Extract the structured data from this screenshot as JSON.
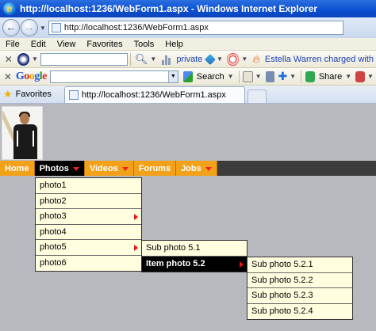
{
  "window": {
    "title": "http://localhost:1236/WebForm1.aspx - Windows Internet Explorer",
    "logo_letter": "e"
  },
  "address": {
    "url": "http://localhost:1236/WebForm1.aspx"
  },
  "menubar": [
    "File",
    "Edit",
    "View",
    "Favorites",
    "Tools",
    "Help"
  ],
  "toolbar1": {
    "private_label": "private",
    "news_text": "Estella Warren charged with"
  },
  "toolbar2": {
    "google": [
      "G",
      "o",
      "o",
      "g",
      "l",
      "e"
    ],
    "search_label": "Search",
    "share_label": "Share"
  },
  "tabs": {
    "favorites_label": "Favorites",
    "active_tab": "http://localhost:1236/WebForm1.aspx"
  },
  "site_nav": [
    {
      "label": "Home",
      "has_caret": false,
      "active": false
    },
    {
      "label": "Photos",
      "has_caret": true,
      "active": true
    },
    {
      "label": "Videos",
      "has_caret": true,
      "active": false
    },
    {
      "label": "Forums",
      "has_caret": false,
      "active": false
    },
    {
      "label": "Jobs",
      "has_caret": true,
      "active": false
    }
  ],
  "photos_menu": [
    {
      "label": "photo1",
      "has_sub": false
    },
    {
      "label": "photo2",
      "has_sub": false
    },
    {
      "label": "photo3",
      "has_sub": true
    },
    {
      "label": "photo4",
      "has_sub": false
    },
    {
      "label": "photo5",
      "has_sub": true
    },
    {
      "label": "photo6",
      "has_sub": false
    }
  ],
  "photo5_menu": [
    {
      "label": "Sub photo 5.1",
      "has_sub": false,
      "highlight": false
    },
    {
      "label": "Item photo 5.2",
      "has_sub": true,
      "highlight": true
    }
  ],
  "photo52_menu": [
    {
      "label": "Sub photo 5.2.1"
    },
    {
      "label": "Sub photo 5.2.2"
    },
    {
      "label": "Sub photo 5.2.3"
    },
    {
      "label": "Sub photo 5.2.4"
    }
  ],
  "colors": {
    "nav_orange": "#f2a11a",
    "nav_bar": "#3c3c3c",
    "menu_bg": "#ffffe0",
    "caret_red": "#e22",
    "page_bg": "#b8b8bf"
  }
}
